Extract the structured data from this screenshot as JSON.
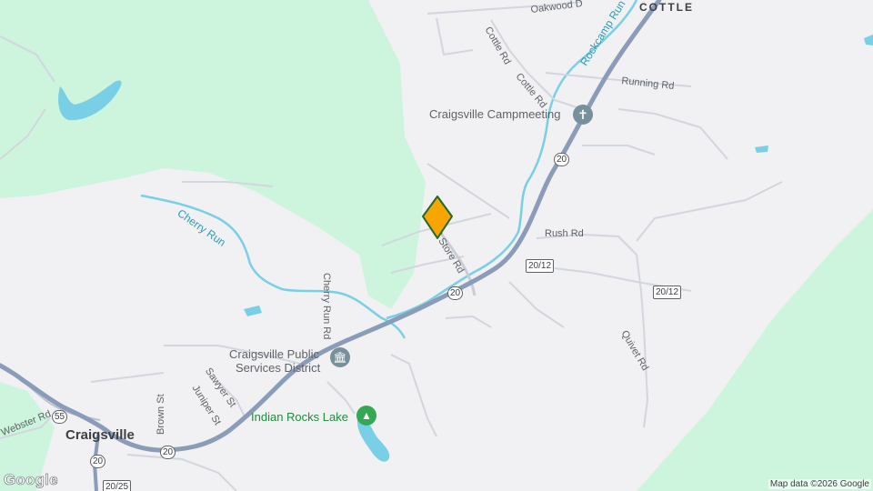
{
  "map": {
    "attribution": "Map data ©2026 Google",
    "logo": "Google",
    "colors": {
      "land": "#f1f0f3",
      "forest": "#cdf5dd",
      "water": "#78cfe6",
      "highway": "#8b9cb8",
      "minor_road": "#d2d6de",
      "marker": "#f7a500",
      "marker_border": "#1e6b2b"
    },
    "localities": {
      "cottle": "COTTLE",
      "craigsville": "Craigsville"
    },
    "pois": {
      "campmeeting": {
        "name": "Craigsville Campmeeting",
        "icon": "church-icon"
      },
      "public_services": {
        "name": "Craigsville Public Services District",
        "line1": "Craigsville Public",
        "line2": "Services District",
        "icon": "government-building-icon"
      },
      "lake": {
        "name": "Indian Rocks Lake",
        "icon": "tree-icon"
      }
    },
    "roads": {
      "oakwood": "Oakwood D",
      "cottle_rd_1": "Cottle Rd",
      "cottle_rd_2": "Cottle Rd",
      "running": "Running Rd",
      "rush": "Rush Rd",
      "old_store": "Old Store Rd",
      "cherry_run_rd": "Cherry Run Rd",
      "sawyer": "Sawyer St",
      "juniper": "Juniper St",
      "brown": "Brown St",
      "quivet": "Quivet Rd",
      "webster": "Webster Rd"
    },
    "waterways": {
      "rockcamp": "Rockcamp Run",
      "cherry": "Cherry Run"
    },
    "shields": {
      "r20_top": "20",
      "r20_mid": "20",
      "r20_bottom": "20",
      "r20_12_a": "20/12",
      "r20_12_b": "20/12",
      "r55": "55",
      "r20_25": "20/25"
    },
    "marker": {
      "icon": "location-pin-icon"
    }
  }
}
